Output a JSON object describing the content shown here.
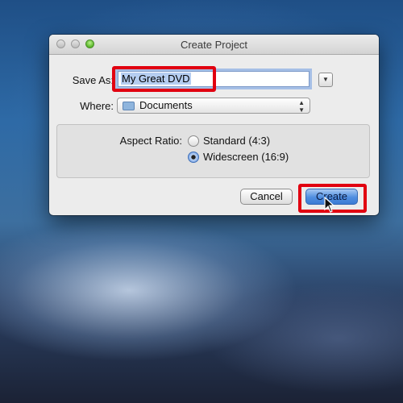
{
  "dialog": {
    "title": "Create Project",
    "save_as_label": "Save As:",
    "save_as_value": "My Great DVD",
    "where_label": "Where:",
    "where_value": "Documents",
    "aspect_label": "Aspect Ratio:",
    "aspect_options": [
      {
        "label": "Standard (4:3)",
        "selected": false
      },
      {
        "label": "Widescreen (16:9)",
        "selected": true
      }
    ],
    "cancel_label": "Cancel",
    "create_label": "Create"
  },
  "colors": {
    "highlight": "#e10010",
    "default_button": "#4f8ee0"
  },
  "icons": [
    "close-icon",
    "minimize-icon",
    "zoom-icon",
    "dropdown-arrow-icon",
    "folder-icon",
    "popup-arrows-icon",
    "cursor-arrow-icon"
  ]
}
